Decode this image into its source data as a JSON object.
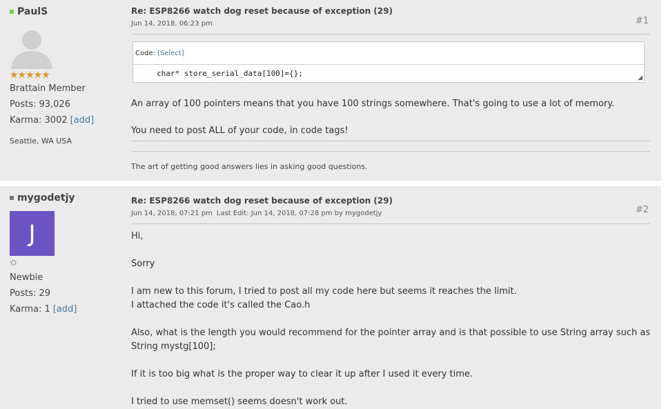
{
  "post1": {
    "username": "PaulS",
    "status_color": "#7bcf4a",
    "rank_stars": "★★★★★",
    "title": "Brattain Member",
    "posts": "Posts: 93,026",
    "karma": "Karma: 3002",
    "add_label": "[add]",
    "location": "Seattle, WA USA",
    "subject": "Re: ESP8266 watch dog reset because of exception (29)",
    "date": "Jun 14, 2018, 06:23 pm",
    "post_number": "#1",
    "code_label": "Code:",
    "select_label": "[Select]",
    "code": "char* store_serial_data[100]={};",
    "paragraphs": [
      "An array of 100 pointers means that you have 100 strings somewhere. That's going to use a lot of memory.",
      "You need to post ALL of your code, in code tags!"
    ],
    "signature": "The art of getting good answers lies in asking good questions."
  },
  "post2": {
    "username": "mygodetjy",
    "status_color": "#777777",
    "avatar_letter": "J",
    "avatar_color": "#6b53c3",
    "rank_star": "✩",
    "title": "Newbie",
    "posts": "Posts: 29",
    "karma": "Karma: 1",
    "add_label": "[add]",
    "subject": "Re: ESP8266 watch dog reset because of exception (29)",
    "date": "Jun 14, 2018, 07:21 pm",
    "last_edit": "Last Edit: Jun 14, 2018, 07:28 pm by mygodetjy",
    "post_number": "#2",
    "paragraphs": [
      "Hi,",
      "Sorry",
      "I am new to this forum, I tried to post all my code here but seems it reaches the limit.",
      "I attached the code it's called the  Cao.h",
      "Also, what is the length you would recommend for the pointer array and is that possible to use String array such as",
      "String mystg[100];",
      "If it is too big what is the proper way to clear it up after I used it every time.",
      "I tried to use memset() seems doesn't work out."
    ]
  }
}
